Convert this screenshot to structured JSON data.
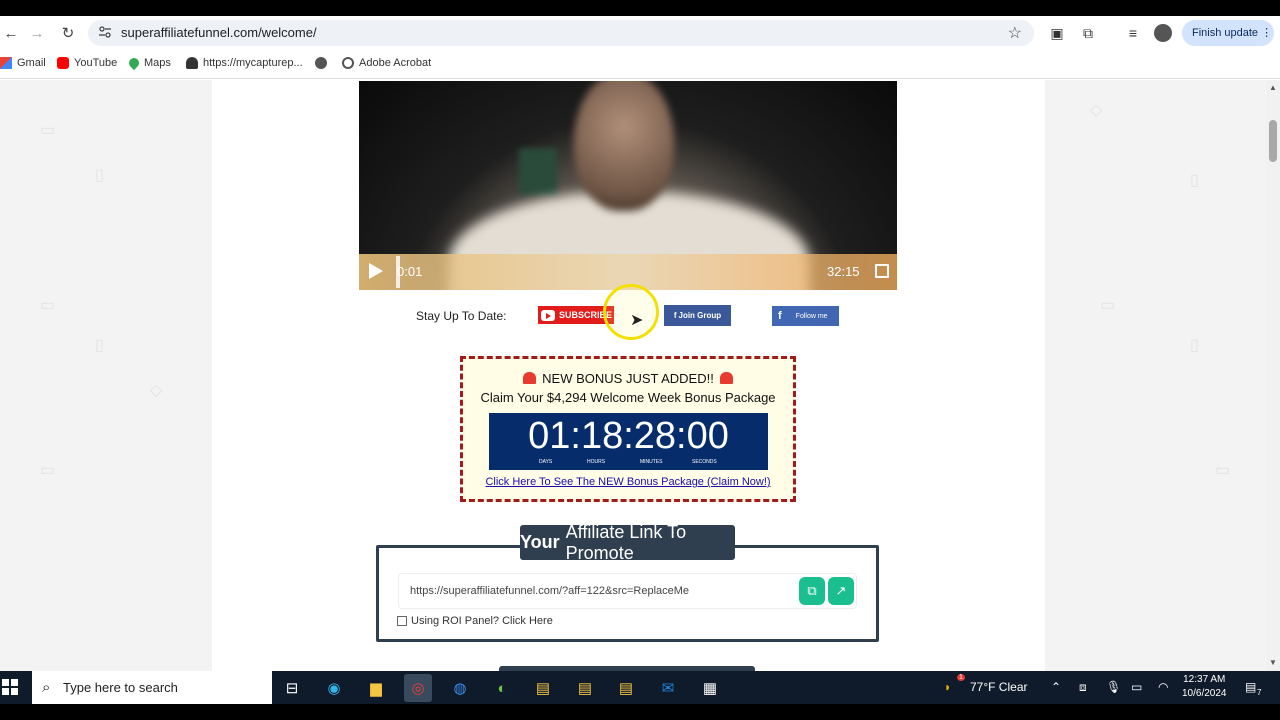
{
  "browser": {
    "url": "superaffiliatefunnel.com/welcome/",
    "finish_update_label": "Finish update",
    "bookmarks": [
      {
        "label": "Gmail",
        "icon": "gmail-icon"
      },
      {
        "label": "YouTube",
        "icon": "youtube-icon"
      },
      {
        "label": "Maps",
        "icon": "maps-icon"
      },
      {
        "label": "https://mycapturep...",
        "icon": "user-icon"
      },
      {
        "label": "",
        "icon": "globe-icon"
      },
      {
        "label": "Adobe Acrobat",
        "icon": "globe-icon"
      }
    ]
  },
  "video": {
    "current_time": "0:01",
    "duration": "32:15"
  },
  "social": {
    "stay_label": "Stay Up To Date:",
    "subscribe_label": "SUBSCRIBE",
    "join_group_label": "Join Group",
    "follow_label": "Follow me"
  },
  "bonus": {
    "title": "NEW BONUS JUST ADDED!!",
    "subtitle": "Claim Your $4,294 Welcome Week Bonus Package",
    "timer": "01:18:28:00",
    "timer_labels": [
      "DAYS",
      "HOURS",
      "MINUTES",
      "SECONDS"
    ],
    "link_text": "Click Here To See The NEW Bonus Package (Claim Now!)"
  },
  "affiliate": {
    "tab_bold": "Your",
    "tab_rest": "Affiliate Link To Promote",
    "url": "https://superaffiliatefunnel.com/?aff=122&src=ReplaceMe",
    "roi_label": "Using ROI Panel? Click Here",
    "roi_checked": false
  },
  "taskbar": {
    "search_placeholder": "Type here to search",
    "weather": "77°F  Clear",
    "weather_badge": "1",
    "time": "12:37 AM",
    "date": "10/6/2024",
    "notification_count": "7"
  },
  "colors": {
    "accent_green": "#1bbf8f",
    "dark_panel": "#2f3f4f",
    "timer_bg": "#072c6b",
    "bonus_border": "#a21b1b"
  }
}
